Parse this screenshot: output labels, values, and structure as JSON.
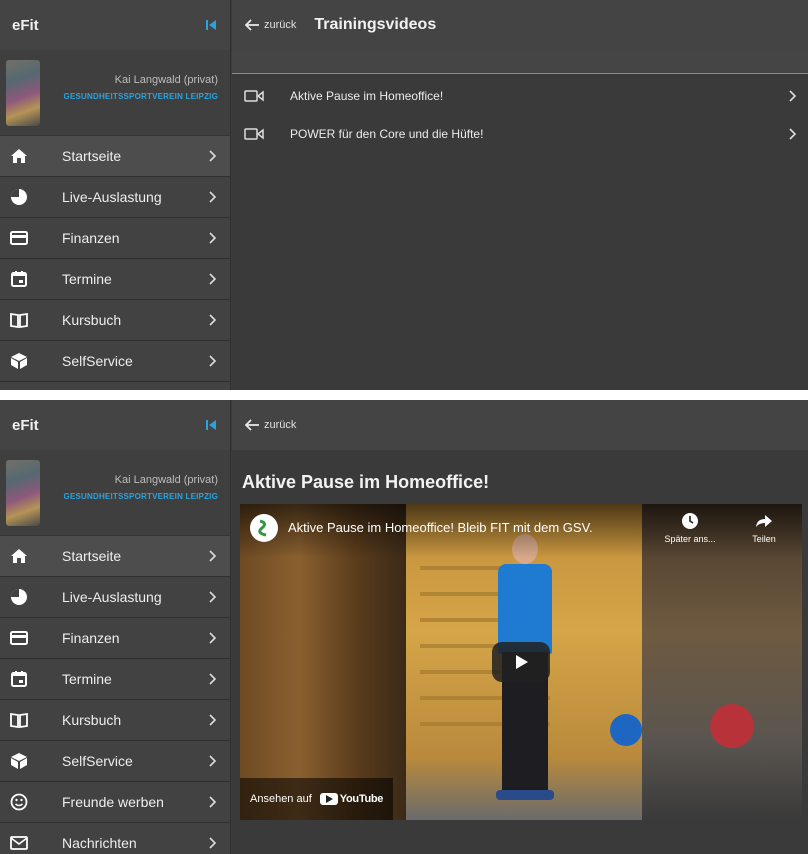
{
  "app": {
    "title": "eFit"
  },
  "profile": {
    "name": "Kai Langwald (privat)",
    "club": "GESUNDHEITSSPORTVEREIN LEIPZIG"
  },
  "menu": {
    "items": [
      {
        "label": "Startseite",
        "icon": "home-icon"
      },
      {
        "label": "Live-Auslastung",
        "icon": "pie-chart-icon"
      },
      {
        "label": "Finanzen",
        "icon": "credit-card-icon"
      },
      {
        "label": "Termine",
        "icon": "calendar-icon"
      },
      {
        "label": "Kursbuch",
        "icon": "book-icon"
      },
      {
        "label": "SelfService",
        "icon": "box-icon"
      },
      {
        "label": "Freunde werben",
        "icon": "smiley-icon"
      },
      {
        "label": "Nachrichten",
        "icon": "mail-icon"
      }
    ]
  },
  "list_view": {
    "back_label": "zurück",
    "title": "Trainingsvideos",
    "videos": [
      {
        "title": "Aktive Pause im Homeoffice!"
      },
      {
        "title": "POWER für den Core und die Hüfte!"
      }
    ]
  },
  "detail_view": {
    "back_label": "zurück",
    "heading": "Aktive Pause im Homeoffice!",
    "player": {
      "video_title": "Aktive Pause im Homeoffice! Bleib FIT mit dem GSV.",
      "watch_later_label": "Später ans...",
      "share_label": "Teilen",
      "watch_on_label": "Ansehen auf",
      "youtube_label": "YouTube"
    }
  },
  "colors": {
    "accent_blue": "#2aa3e0",
    "sidebar_bg": "#424242",
    "main_bg": "#3a3a3a"
  }
}
